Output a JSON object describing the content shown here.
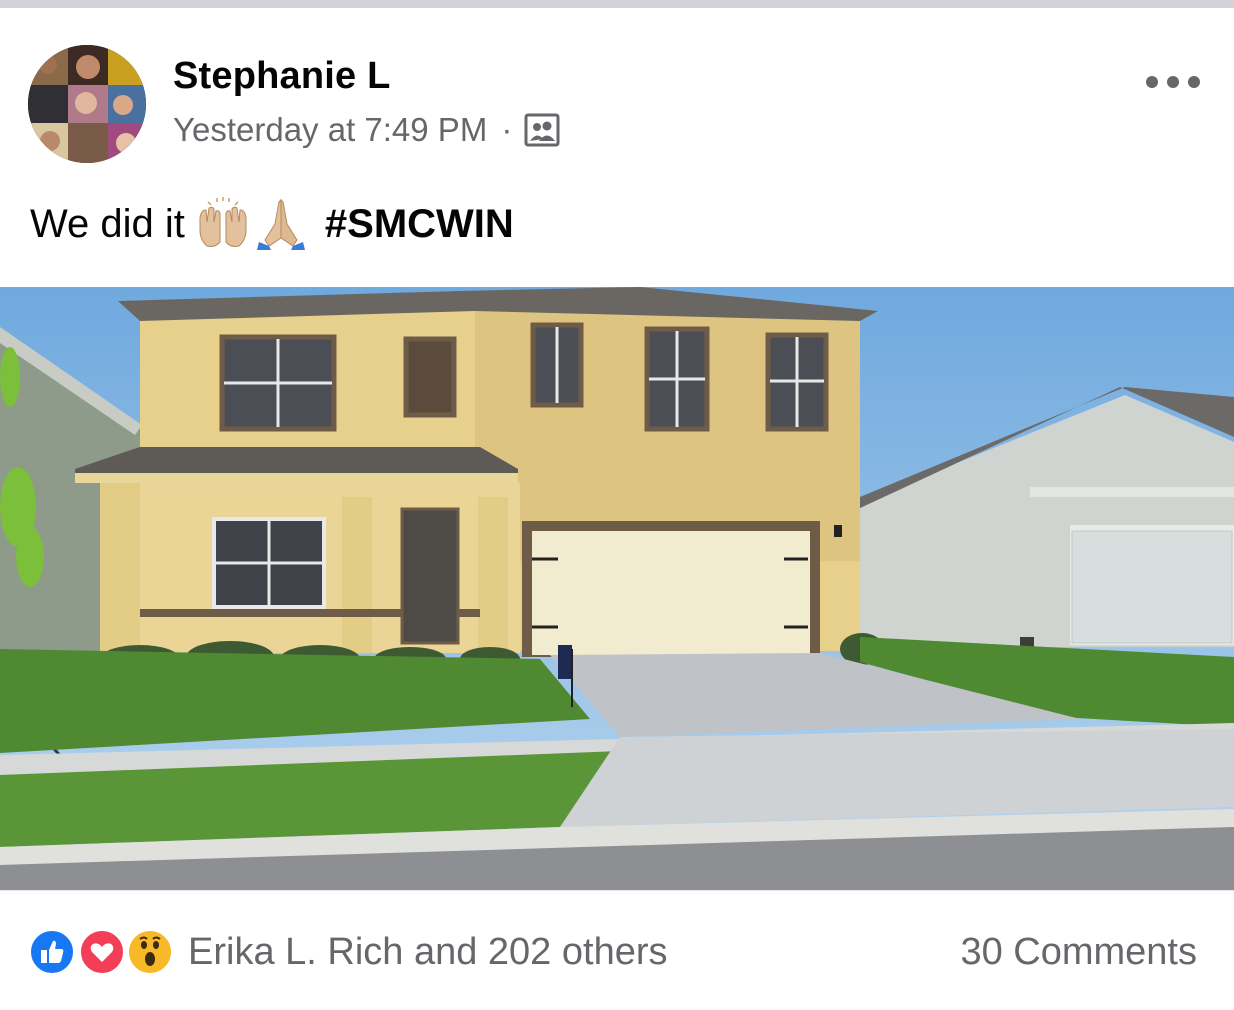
{
  "post": {
    "author": "Stephanie L",
    "timestamp": "Yesterday at 7:49 PM",
    "separator": "·",
    "audience_icon": "friends-icon",
    "more_icon": "more-dots-icon",
    "text": "We did it",
    "emojis": [
      "raising-hands-emoji",
      "folded-hands-emoji"
    ],
    "hashtag": "#SMCWIN"
  },
  "photo": {
    "subject": "two-story-house-photo"
  },
  "footer": {
    "reaction_icons": [
      "like-icon",
      "love-icon",
      "wow-icon"
    ],
    "reactions_text": "Erika L. Rich and 202 others",
    "comments_text": "30 Comments"
  },
  "colors": {
    "name_text": "#050505",
    "secondary_text": "#65676b",
    "like_blue": "#1877f2",
    "love_red": "#f33e58",
    "wow_yellow": "#f7b928"
  }
}
